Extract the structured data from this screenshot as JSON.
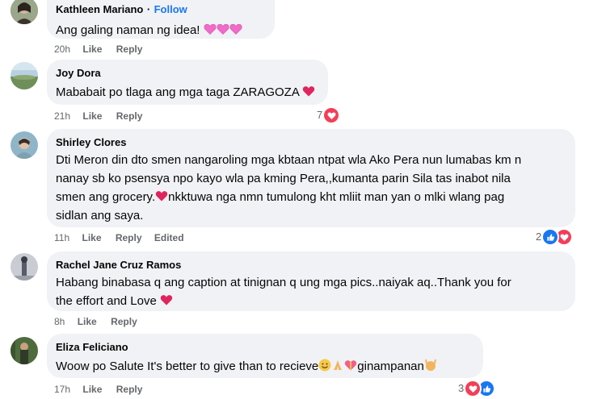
{
  "comments": [
    {
      "author": "Kathleen Mariano",
      "follow": "Follow",
      "sep": "·",
      "text": "Ang galing naman ng idea!",
      "time": "20h",
      "like": "Like",
      "reply": "Reply"
    },
    {
      "author": "Joy Dora",
      "text": "Mababait po tlaga ang mga taga ZARAGOZA",
      "time": "21h",
      "like": "Like",
      "reply": "Reply",
      "reaction_count": "7"
    },
    {
      "author": "Shirley Clores",
      "line1": "Dti Meron din dto smen nangaroling mga kbtaan ntpat wla Ako Pera nun lumabas km n",
      "line2": "nanay sb ko psensya npo kayo wla pa kming Pera,,kumanta parin Sila tas inabot nila",
      "line3a": "smen ang grocery.",
      "line3b": "nkktuwa nga nmn tumulong kht mliit man yan o mlki wlang pag",
      "line4": "sidlan ang saya.",
      "time": "11h",
      "like": "Like",
      "reply": "Reply",
      "edited": "Edited",
      "reaction_count": "2"
    },
    {
      "author": "Rachel Jane Cruz Ramos",
      "line1": "Habang binabasa q ang caption at tinignan q ung mga pics..naiyak aq..Thank you for",
      "line2": "the effort and Love",
      "time": "8h",
      "like": "Like",
      "reply": "Reply"
    },
    {
      "author": "Eliza Feliciano",
      "text_a": "Woow po Salute It's better to give than to recieve",
      "text_b": "ginampanan",
      "time": "17h",
      "like": "Like",
      "reply": "Reply",
      "reaction_count": "3"
    }
  ],
  "colors": {
    "bubble": "#f0f2f5",
    "meta": "#65676b",
    "follow": "#1877f2",
    "heart": "#f33e58",
    "pink_heart": "#f06cc8"
  }
}
